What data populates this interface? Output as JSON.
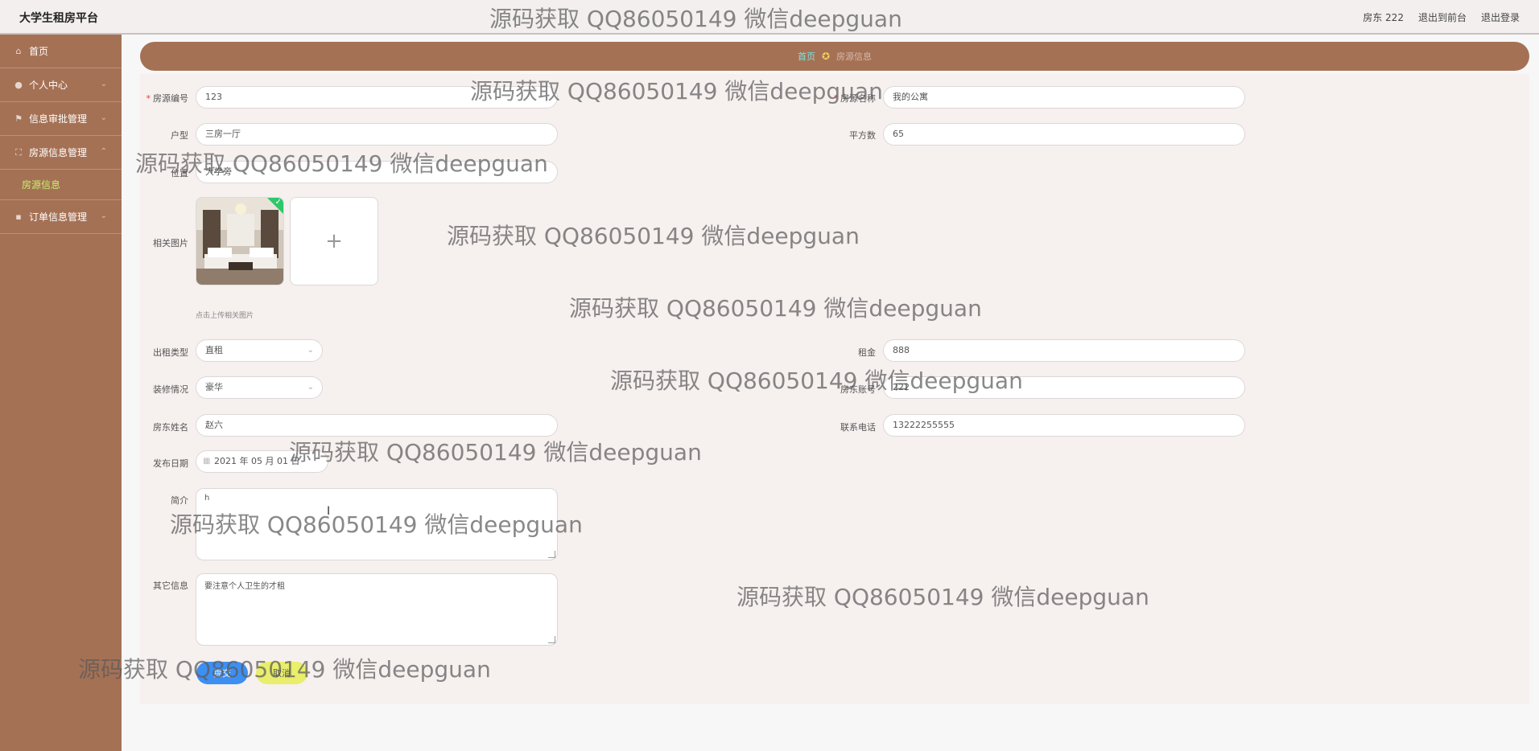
{
  "header": {
    "app_title": "大学生租房平台",
    "user": "房东 222",
    "to_front": "退出到前台",
    "logout": "退出登录"
  },
  "sidebar": {
    "items": [
      {
        "label": "首页",
        "icon": "home-icon"
      },
      {
        "label": "个人中心",
        "icon": "user-icon"
      },
      {
        "label": "信息审批管理",
        "icon": "flag-icon"
      },
      {
        "label": "房源信息管理",
        "icon": "frame-icon"
      },
      {
        "label": "订单信息管理",
        "icon": "chat-icon"
      }
    ],
    "sub_item": "房源信息"
  },
  "breadcrumb": {
    "home": "首页",
    "current": "房源信息"
  },
  "form": {
    "house_no": {
      "label": "房源编号",
      "value": "123"
    },
    "house_name": {
      "label": "房源名称",
      "value": "我的公寓"
    },
    "layout": {
      "label": "户型",
      "value": "三房一厅"
    },
    "area": {
      "label": "平方数",
      "value": "65"
    },
    "location": {
      "label": "位置",
      "value": "大学旁"
    },
    "images": {
      "label": "相关图片",
      "tip": "点击上传相关图片"
    },
    "rent_type": {
      "label": "出租类型",
      "value": "直租"
    },
    "rent": {
      "label": "租金",
      "value": "888"
    },
    "decoration": {
      "label": "装修情况",
      "value": "豪华"
    },
    "landlord_account": {
      "label": "房东账号",
      "value": "222"
    },
    "landlord_name": {
      "label": "房东姓名",
      "value": "赵六"
    },
    "phone": {
      "label": "联系电话",
      "value": "13222255555"
    },
    "publish_date": {
      "label": "发布日期",
      "value": "2021 年 05 月 01 日"
    },
    "intro": {
      "label": "简介",
      "value": "h"
    },
    "other": {
      "label": "其它信息",
      "value": "要注意个人卫生的才租"
    },
    "submit": "提交",
    "cancel": "取消"
  },
  "watermark": "源码获取 QQ86050149 微信deepguan",
  "colors": {
    "sidebar": "#a57155",
    "sub_active": "#c6f06b",
    "submit": "#3d8ff2",
    "cancel": "#e9ee6c"
  }
}
